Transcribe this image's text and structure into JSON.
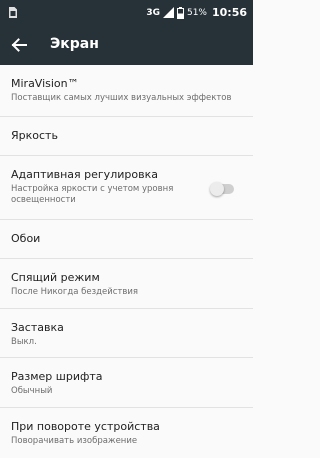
{
  "status_bar": {
    "network": "3G",
    "battery_percent": "51%",
    "time": "10:56",
    "icons": [
      "sim-card-icon",
      "signal-icon",
      "battery-icon"
    ]
  },
  "toolbar": {
    "back_icon": "arrow-back-icon",
    "title": "Экран"
  },
  "settings": [
    {
      "title": "MiraVision™",
      "summary": "Поставщик самых лучших визуальных эффектов"
    },
    {
      "title": "Яркость",
      "summary": ""
    },
    {
      "title": "Адаптивная регулировка",
      "summary": "Настройка яркости с учетом уровня освещенности",
      "toggle": false
    },
    {
      "title": "Обои",
      "summary": ""
    },
    {
      "title": "Спящий режим",
      "summary": "После Никогда бездействия"
    },
    {
      "title": "Заставка",
      "summary": "Выкл."
    },
    {
      "title": "Размер шрифта",
      "summary": "Обычный"
    },
    {
      "title": "При повороте устройства",
      "summary": "Поворачивать изображение"
    }
  ],
  "colors": {
    "toolbar_bg": "#263238",
    "background": "#fafafa",
    "divider": "#e2e2e2"
  }
}
